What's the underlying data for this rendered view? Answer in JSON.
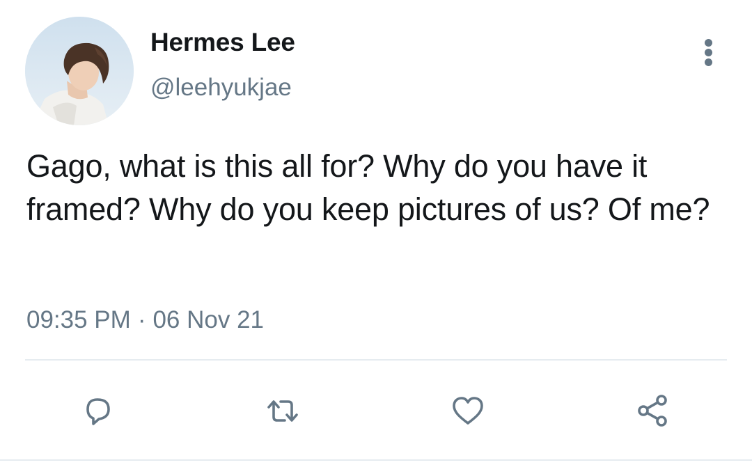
{
  "tweet": {
    "author": {
      "display_name": "Hermes Lee",
      "handle": "@leehyukjae",
      "avatar_icon": "profile-photo"
    },
    "text": "Gago, what is this all for? Why do you have it framed? Why do you keep pictures of us? Of me?",
    "time": "09:35 PM",
    "separator": "·",
    "date": "06 Nov 21"
  },
  "actions": {
    "reply_icon": "reply-icon",
    "retweet_icon": "retweet-icon",
    "like_icon": "heart-icon",
    "share_icon": "share-icon",
    "more_icon": "more-vertical-icon"
  },
  "colors": {
    "text": "#14171a",
    "secondary": "#657786",
    "divider": "#e6ecf0"
  }
}
